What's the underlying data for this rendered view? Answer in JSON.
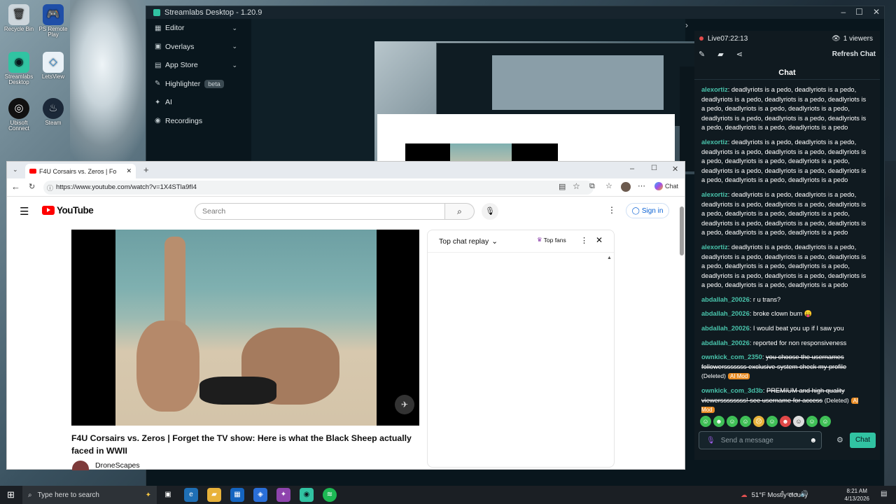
{
  "desktop": {
    "icons": [
      {
        "label": "Recycle Bin"
      },
      {
        "label": "PS Remote Play"
      },
      {
        "label": "Streamlabs Desktop"
      },
      {
        "label": "LetsView"
      },
      {
        "label": "Ubisoft Connect"
      },
      {
        "label": "Steam"
      }
    ]
  },
  "streamlabs": {
    "title": "Streamlabs Desktop - 1.20.9",
    "sidebar": [
      {
        "label": "Editor"
      },
      {
        "label": "Overlays"
      },
      {
        "label": "App Store"
      },
      {
        "label": "Highlighter",
        "badge": "beta"
      },
      {
        "label": "AI"
      },
      {
        "label": "Recordings"
      }
    ],
    "live_label": "Live",
    "live_time": "07:22:13",
    "viewers": "1 viewers",
    "refresh_label": "Refresh Chat",
    "chat_title": "Chat",
    "messages": [
      {
        "user": "alexortiz",
        "text": "deadlyriots is a pedo, deadlyriots is a pedo, deadlyriots is a pedo, deadlyriots is a pedo, deadlyriots is a pedo, deadlyriots is a pedo, deadlyriots is a pedo, deadlyriots is a pedo, deadlyriots is a pedo, deadlyriots is a pedo, deadlyriots is a pedo, deadlyriots is a pedo"
      },
      {
        "user": "alexortiz",
        "text": "deadlyriots is a pedo, deadlyriots is a pedo, deadlyriots is a pedo, deadlyriots is a pedo, deadlyriots is a pedo, deadlyriots is a pedo, deadlyriots is a pedo, deadlyriots is a pedo, deadlyriots is a pedo, deadlyriots is a pedo, deadlyriots is a pedo, deadlyriots is a pedo"
      },
      {
        "user": "alexortiz",
        "text": "deadlyriots is a pedo, deadlyriots is a pedo, deadlyriots is a pedo, deadlyriots is a pedo, deadlyriots is a pedo, deadlyriots is a pedo, deadlyriots is a pedo, deadlyriots is a pedo, deadlyriots is a pedo, deadlyriots is a pedo, deadlyriots is a pedo, deadlyriots is a pedo"
      },
      {
        "user": "alexortiz",
        "text": "deadlyriots is a pedo, deadlyriots is a pedo, deadlyriots is a pedo, deadlyriots is a pedo, deadlyriots is a pedo, deadlyriots is a pedo, deadlyriots is a pedo, deadlyriots is a pedo, deadlyriots is a pedo, deadlyriots is a pedo, deadlyriots is a pedo, deadlyriots is a pedo"
      },
      {
        "user": "abdallah_20026",
        "text": "r u trans?"
      },
      {
        "user": "abdallah_20026",
        "text": "broke clown bum 😛"
      },
      {
        "user": "abdallah_20026",
        "text": "I would beat you up if I saw you"
      },
      {
        "user": "abdallah_20026",
        "text": "reported for non responsiveness"
      }
    ],
    "deleted_messages": [
      {
        "user": "ownkick_com_2350",
        "text": "you choose the usernames followersssssss exclusive system check my profile",
        "tag": "(Deleted)",
        "mod": "AI Mod"
      },
      {
        "user": "ownkick_com_3d3b",
        "text": "PREMIUM and high quality viewerssssssss! see username for access",
        "tag": "(Deleted)",
        "mod": "AI Mod"
      }
    ],
    "input_placeholder": "Send a message",
    "send_label": "Chat",
    "accent": "#31c3a2"
  },
  "browser": {
    "tab_title": "F4U Corsairs vs. Zeros | Forget",
    "url": "https://www.youtube.com/watch?v=1X4STla9fI4",
    "copilot_label": "Chat",
    "search_placeholder": "Search",
    "signin_label": "Sign in",
    "logo_text": "YouTube",
    "video_title": "F4U Corsairs vs. Zeros | Forget the TV show: Here is what the Black Sheep actually faced in WWII",
    "channel": "DroneScapes",
    "chat_mode": "Top chat replay",
    "top_fans": "Top fans"
  },
  "taskbar": {
    "search_placeholder": "Type here to search",
    "weather": "51°F  Mostly cloudy",
    "time": "8:21 AM",
    "date": "4/13/2026"
  }
}
